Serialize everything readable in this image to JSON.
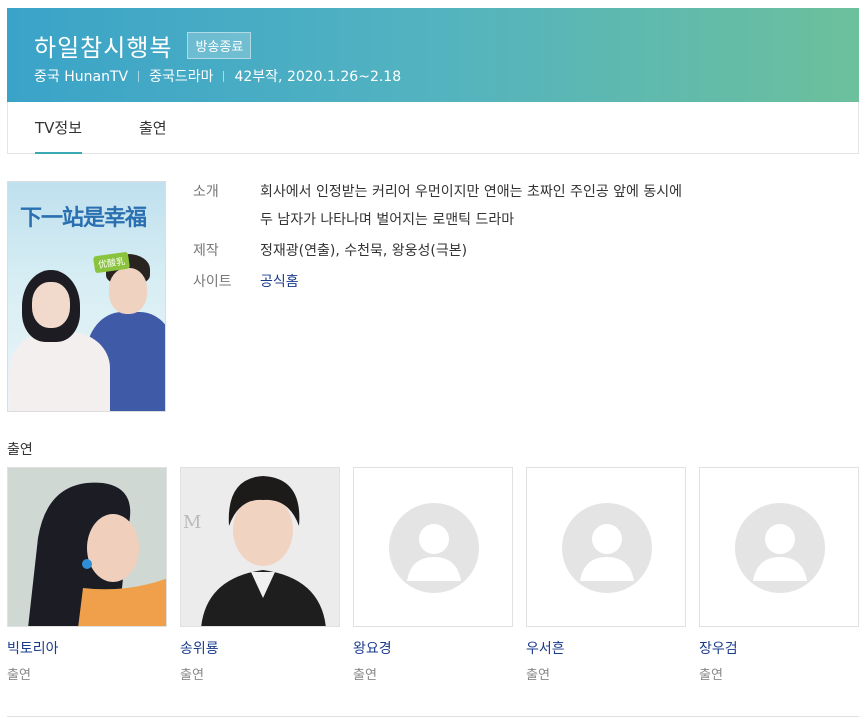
{
  "header": {
    "title": "하일참시행복",
    "status_badge": "방송종료",
    "meta": [
      "중국 HunanTV",
      "중국드라마",
      "42부작, 2020.1.26~2.18"
    ],
    "gradient_start": "#3aa3c8",
    "gradient_end": "#6cc09c"
  },
  "tabs": [
    {
      "label": "TV정보",
      "active": true
    },
    {
      "label": "출연",
      "active": false
    }
  ],
  "poster": {
    "title_text": "下一站是幸福",
    "tag_text": "优酸乳"
  },
  "info": {
    "intro_label": "소개",
    "intro_line1": "회사에서 인정받는 커리어 우먼이지만 연애는 초짜인 주인공 앞에 동시에",
    "intro_line2": "두 남자가 나타나며 벌어지는 로맨틱 드라마",
    "production_label": "제작",
    "production_value": "정재광(연출), 수천묵, 왕웅성(극본)",
    "site_label": "사이트",
    "site_link": "공식홈"
  },
  "cast": {
    "heading": "출연",
    "members": [
      {
        "name": "빅토리아",
        "role": "출연",
        "photo": "photo"
      },
      {
        "name": "송위룡",
        "role": "출연",
        "photo": "photo"
      },
      {
        "name": "왕요경",
        "role": "출연",
        "photo": "placeholder"
      },
      {
        "name": "우서흔",
        "role": "출연",
        "photo": "placeholder"
      },
      {
        "name": "장우검",
        "role": "출연",
        "photo": "placeholder"
      }
    ]
  },
  "colors": {
    "accent": "#3aa8b5",
    "link": "#1a3b8c"
  }
}
